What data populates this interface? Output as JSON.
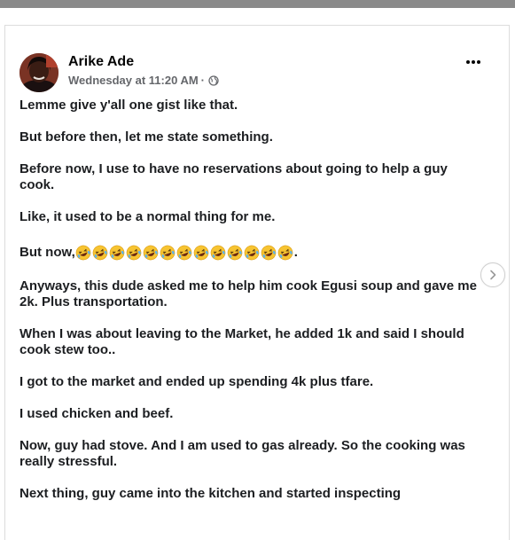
{
  "post": {
    "author": "Arike Ade",
    "timestamp": "Wednesday at 11:20 AM",
    "separator": "·",
    "privacy_icon": "globe-icon",
    "more_icon": "more-options-icon"
  },
  "paragraphs": {
    "p1": "Lemme give y'all one gist like that.",
    "p2": "But before then, let me state something.",
    "p3": "Before now, I use to have no reservations about going to help a guy cook.",
    "p4": "Like, it used to be a normal thing for me.",
    "p5_prefix": "But now,",
    "p5_suffix": ".",
    "p5_emoji": "🤣",
    "p5_emoji_count": 13,
    "p6": "Anyways, this dude asked me to help him cook Egusi soup and gave me 2k. Plus transportation.",
    "p7": "When I was about leaving to the Market, he added 1k and said I should cook stew too..",
    "p8": "I got to the market and ended up spending 4k plus tfare.",
    "p9": "I used chicken and beef.",
    "p10": "Now, guy had stove. And I am used to gas already. So the cooking was really stressful.",
    "p11": "Next thing, guy came into the kitchen and started inspecting"
  },
  "carousel": {
    "next_icon": "chevron-right-icon"
  },
  "colors": {
    "text": "#1c1e21",
    "meta": "#65676b",
    "emoji_face": "#f7c431"
  }
}
